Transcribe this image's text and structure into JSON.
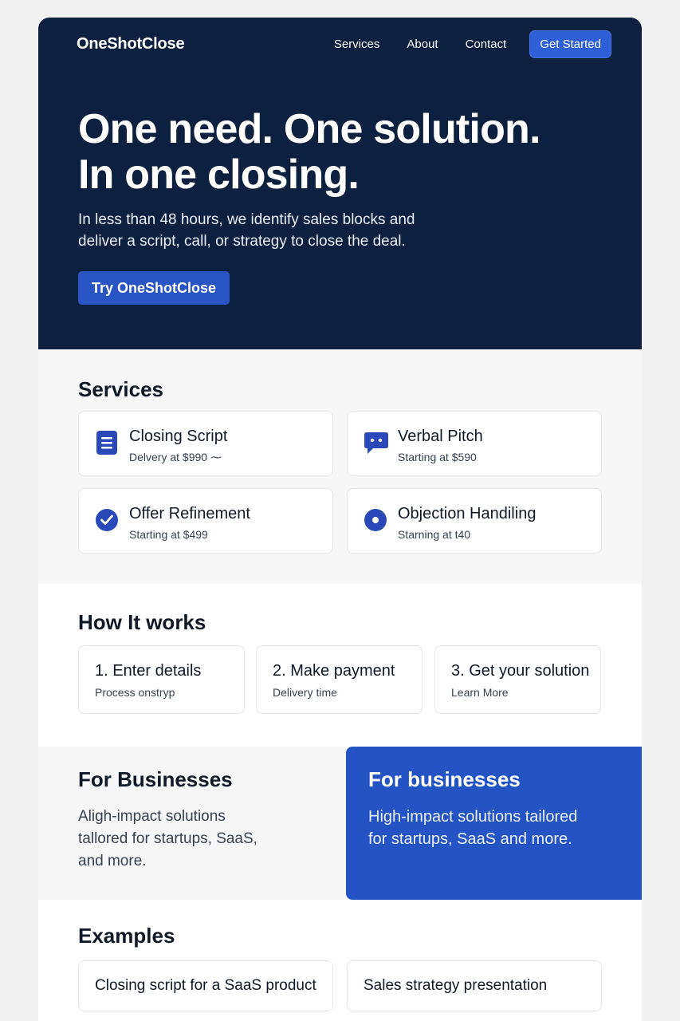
{
  "header": {
    "logo": "OneShotClose",
    "nav": [
      "Services",
      "About",
      "Contact"
    ],
    "cta": "Get Started"
  },
  "hero": {
    "title_line1": "One need. One solution.",
    "title_line2": "In one closing.",
    "subtitle_line1": "In less than 48 hours, we identify sales blocks and",
    "subtitle_line2": "deliver a script, call, or strategy to close the deal.",
    "cta": "Try OneShotClose"
  },
  "services": {
    "title": "Services",
    "items": [
      {
        "name": "Closing Script",
        "price": "Delvery at $990 ⁓",
        "icon": "document-icon"
      },
      {
        "name": "Verbal Pitch",
        "price": "Starting at $590",
        "icon": "chat-bubble-icon"
      },
      {
        "name": "Offer Refinement",
        "price": "Starting at $499",
        "icon": "checkmark-circle-icon"
      },
      {
        "name": "Objection Handiling",
        "price": "Starning at t40",
        "icon": "dot-circle-icon"
      }
    ]
  },
  "how": {
    "title": "How It works",
    "steps": [
      {
        "title": "1. Enter details",
        "desc": "Process onstryp"
      },
      {
        "title": "2. Make payment",
        "desc": "Delivery time"
      },
      {
        "title": "3. Get your solution",
        "desc": "Learn More"
      }
    ]
  },
  "business": {
    "left_title": "For Businesses",
    "left_text": "Aligh-impact solutions tallored for startups, SaaS, and more.",
    "right_title": "For businesses",
    "right_text": "High-impact solutions tailored for startups, SaaS and more."
  },
  "examples": {
    "title": "Examples",
    "items": [
      "Closing script for a SaaS product",
      "Sales strategy presentation"
    ]
  },
  "colors": {
    "hero_bg": "#0d2040",
    "accent": "#2954c4",
    "icon": "#2a49b8"
  }
}
